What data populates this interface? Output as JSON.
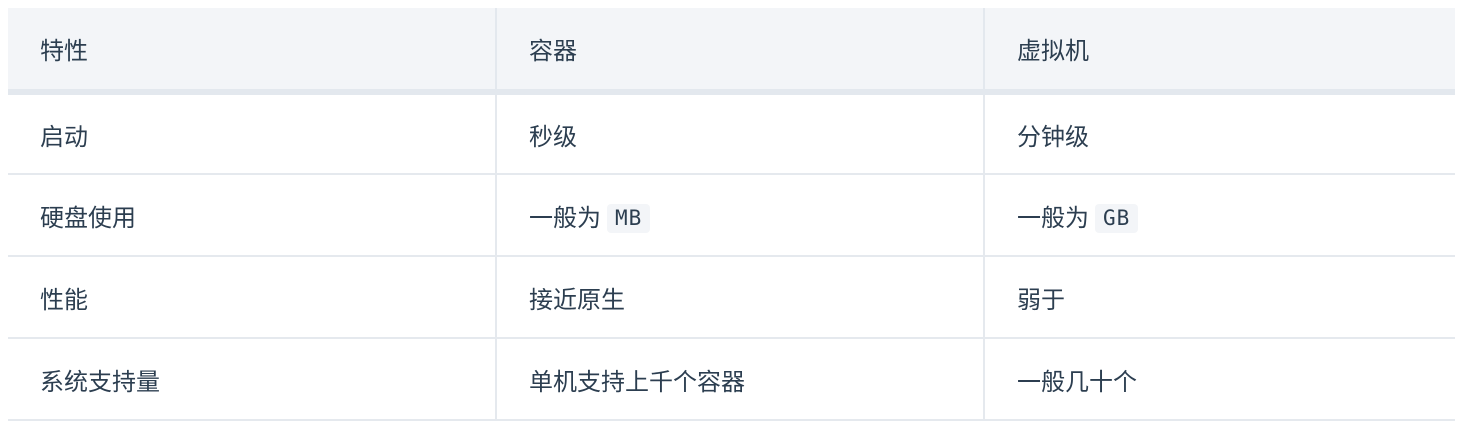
{
  "table": {
    "headers": [
      "特性",
      "容器",
      "虚拟机"
    ],
    "rows": [
      {
        "feature": "启动",
        "container": "秒级",
        "vm": "分钟级"
      },
      {
        "feature": "硬盘使用",
        "container_text": "一般为",
        "container_code": "MB",
        "vm_text": "一般为",
        "vm_code": "GB"
      },
      {
        "feature": "性能",
        "container": "接近原生",
        "vm": "弱于"
      },
      {
        "feature": "系统支持量",
        "container": "单机支持上千个容器",
        "vm": "一般几十个"
      }
    ]
  },
  "colors": {
    "text": "#2c3e50",
    "header_bg": "#f3f5f8",
    "border": "#e5e9ee",
    "code_bg": "#f3f5f8"
  }
}
